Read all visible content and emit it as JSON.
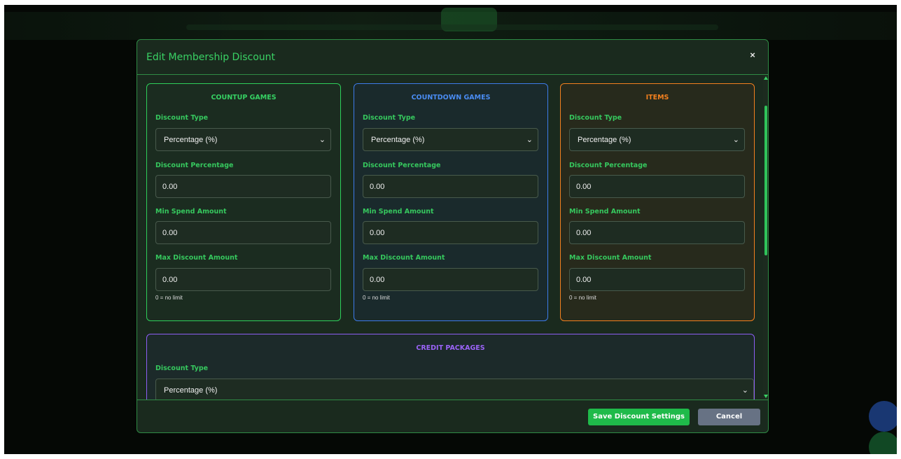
{
  "modal": {
    "title": "Edit Membership Discount",
    "close_symbol": "×",
    "colors": {
      "accent_green": "#39d164",
      "accent_blue": "#4a8cf2",
      "accent_orange": "#f3801e",
      "accent_purple": "#9a63f7",
      "save_button": "#1fba4a",
      "cancel_button": "#677284"
    }
  },
  "sections": {
    "countup": {
      "title": "COUNTUP GAMES",
      "discount_type_label": "Discount Type",
      "discount_type_value": "Percentage (%)",
      "percentage_label": "Discount Percentage",
      "percentage_value": "0.00",
      "min_spend_label": "Min Spend Amount",
      "min_spend_value": "0.00",
      "max_discount_label": "Max Discount Amount",
      "max_discount_value": "0.00",
      "hint": "0 = no limit"
    },
    "countdown": {
      "title": "COUNTDOWN GAMES",
      "discount_type_label": "Discount Type",
      "discount_type_value": "Percentage (%)",
      "percentage_label": "Discount Percentage",
      "percentage_value": "0.00",
      "min_spend_label": "Min Spend Amount",
      "min_spend_value": "0.00",
      "max_discount_label": "Max Discount Amount",
      "max_discount_value": "0.00",
      "hint": "0 = no limit"
    },
    "items": {
      "title": "ITEMS",
      "discount_type_label": "Discount Type",
      "discount_type_value": "Percentage (%)",
      "percentage_label": "Discount Percentage",
      "percentage_value": "0.00",
      "min_spend_label": "Min Spend Amount",
      "min_spend_value": "0.00",
      "max_discount_label": "Max Discount Amount",
      "max_discount_value": "0.00",
      "hint": "0 = no limit"
    },
    "credit_packages": {
      "title": "CREDIT PACKAGES",
      "discount_type_label": "Discount Type",
      "discount_type_value": "Percentage (%)"
    }
  },
  "footer": {
    "save_label": "Save Discount Settings",
    "cancel_label": "Cancel"
  },
  "icons": {
    "chevron": "chevron-down-icon",
    "close": "close-icon"
  }
}
